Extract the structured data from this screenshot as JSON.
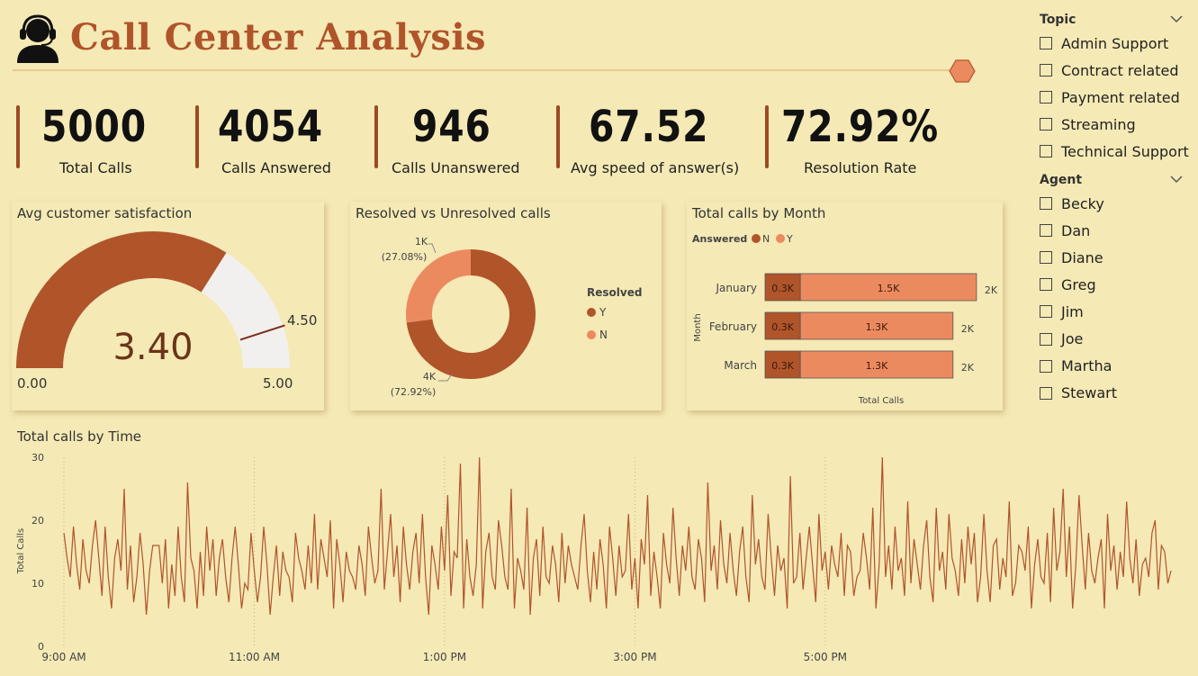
{
  "header": {
    "title": "Call Center Analysis",
    "logo_icon": "call-center-agent-icon"
  },
  "kpis": [
    {
      "value": "5000",
      "label": "Total Calls"
    },
    {
      "value": "4054",
      "label": "Calls Answered"
    },
    {
      "value": "946",
      "label": "Calls Unanswered"
    },
    {
      "value": "67.52",
      "label": "Avg speed of answer(s)"
    },
    {
      "value": "72.92%",
      "label": "Resolution Rate"
    }
  ],
  "gauge": {
    "title": "Avg customer satisfaction",
    "value": 3.4,
    "value_label": "3.40",
    "min": 0,
    "min_label": "0.00",
    "max": 5,
    "max_label": "5.00",
    "target": 4.5,
    "target_label": "4.50"
  },
  "donut": {
    "title": "Resolved vs Unresolved calls",
    "legend_title": "Resolved",
    "slices": [
      {
        "name": "Y",
        "value": 72.92,
        "label": "4K",
        "pct": "(72.92%)"
      },
      {
        "name": "N",
        "value": 27.08,
        "label": "1K",
        "pct": "(27.08%)"
      }
    ]
  },
  "month_chart": {
    "title": "Total calls by Month",
    "legend_title": "Answered",
    "legend": [
      "N",
      "Y"
    ],
    "ylabel": "Month",
    "xlabel": "Total Calls",
    "categories": [
      "January",
      "February",
      "March"
    ],
    "n_labels": [
      "0.3K",
      "0.3K",
      "0.3K"
    ],
    "y_labels": [
      "1.5K",
      "1.3K",
      "1.3K"
    ],
    "total_labels": [
      "2K",
      "2K",
      "2K"
    ]
  },
  "time_chart": {
    "title": "Total calls by Time",
    "ylabel": "Total Calls",
    "y_ticks": [
      "30",
      "20",
      "10",
      "0"
    ],
    "x_ticks": [
      "9:00 AM",
      "11:00 AM",
      "1:00 PM",
      "3:00 PM",
      "5:00 PM"
    ]
  },
  "slicers": {
    "topic": {
      "title": "Topic",
      "options": [
        "Admin Support",
        "Contract related",
        "Payment related",
        "Streaming",
        "Technical Support"
      ]
    },
    "agent": {
      "title": "Agent",
      "options": [
        "Becky",
        "Dan",
        "Diane",
        "Greg",
        "Jim",
        "Joe",
        "Martha",
        "Stewart"
      ]
    }
  },
  "colors": {
    "background": "#f5e9b5",
    "dark": "#b0542a",
    "light": "#ec8a5f",
    "gauge_rest": "#f1f0ee",
    "line": "#b0542a"
  },
  "chart_data": [
    {
      "type": "gauge",
      "title": "Avg customer satisfaction",
      "value": 3.4,
      "min": 0,
      "max": 5,
      "target": 4.5
    },
    {
      "type": "pie",
      "title": "Resolved vs Unresolved calls",
      "categories": [
        "Y",
        "N"
      ],
      "values": [
        72.92,
        27.08
      ]
    },
    {
      "type": "bar",
      "title": "Total calls by Month",
      "categories": [
        "January",
        "February",
        "March"
      ],
      "series": [
        {
          "name": "N",
          "values": [
            300,
            300,
            300
          ]
        },
        {
          "name": "Y",
          "values": [
            1500,
            1300,
            1300
          ]
        }
      ],
      "xlabel": "Total Calls",
      "ylabel": "Month"
    },
    {
      "type": "line",
      "title": "Total calls by Time",
      "xlabel": "",
      "ylabel": "Total Calls",
      "ylim": [
        0,
        30
      ],
      "x_range": [
        "9:00 AM",
        "5:59 PM"
      ],
      "x_start_minutes": 540,
      "step_minutes": 2,
      "series": [
        {
          "name": "Total Calls",
          "values": [
            18,
            14,
            11,
            19,
            13,
            9,
            17,
            12,
            10,
            16,
            20,
            14,
            8,
            19,
            11,
            6,
            14,
            17,
            12,
            25,
            9,
            16,
            7,
            11,
            18,
            13,
            5,
            12,
            16,
            16,
            16,
            10,
            17,
            6,
            13,
            8,
            19,
            11,
            7,
            26,
            14,
            12,
            6,
            15,
            8,
            19,
            12,
            17,
            8,
            14,
            17,
            11,
            7,
            14,
            19,
            13,
            6,
            10,
            9,
            18,
            12,
            7,
            11,
            19,
            13,
            5,
            11,
            16,
            8,
            15,
            12,
            11,
            7,
            18,
            14,
            12,
            9,
            16,
            10,
            21,
            9,
            17,
            14,
            11,
            20,
            6,
            17,
            13,
            7,
            15,
            12,
            11,
            9,
            16,
            13,
            8,
            19,
            14,
            10,
            12,
            25,
            9,
            15,
            21,
            11,
            16,
            7,
            19,
            13,
            9,
            15,
            18,
            10,
            21,
            11,
            5,
            16,
            13,
            9,
            19,
            12,
            24,
            8,
            15,
            14,
            29,
            6,
            17,
            11,
            8,
            13,
            30,
            6,
            15,
            18,
            11,
            9,
            20,
            16,
            11,
            9,
            25,
            6,
            14,
            12,
            9,
            22,
            5,
            14,
            17,
            8,
            19,
            11,
            10,
            16,
            13,
            7,
            18,
            10,
            16,
            13,
            11,
            9,
            16,
            21,
            12,
            7,
            15,
            9,
            17,
            13,
            6,
            19,
            14,
            8,
            16,
            11,
            12,
            21,
            9,
            14,
            6,
            17,
            13,
            24,
            8,
            15,
            11,
            6,
            18,
            13,
            10,
            22,
            14,
            8,
            16,
            12,
            19,
            11,
            9,
            17,
            14,
            7,
            26,
            12,
            16,
            9,
            20,
            13,
            10,
            18,
            12,
            8,
            15,
            19,
            11,
            7,
            24,
            13,
            17,
            11,
            9,
            21,
            14,
            8,
            16,
            12,
            14,
            6,
            27,
            10,
            11,
            18,
            9,
            14,
            19,
            13,
            7,
            21,
            12,
            15,
            9,
            16,
            13,
            11,
            18,
            8,
            16,
            15,
            8,
            11,
            12,
            18,
            14,
            9,
            22,
            6,
            13,
            30,
            11,
            16,
            9,
            19,
            12,
            14,
            8,
            23,
            10,
            17,
            13,
            9,
            16,
            20,
            11,
            7,
            22,
            12,
            15,
            9,
            21,
            14,
            12,
            8,
            17,
            10,
            19,
            13,
            18,
            7,
            11,
            21,
            12,
            7,
            16,
            17,
            9,
            14,
            11,
            23,
            8,
            10,
            16,
            15,
            12,
            19,
            6,
            13,
            17,
            11,
            10,
            18,
            7,
            22,
            12,
            15,
            25,
            11,
            19,
            6,
            13,
            24,
            16,
            9,
            18,
            12,
            10,
            14,
            17,
            6,
            21,
            12,
            16,
            9,
            15,
            11,
            23,
            14,
            10,
            17,
            8,
            13,
            14,
            11,
            18,
            20,
            9,
            16,
            15,
            10,
            12
          ]
        }
      ]
    }
  ]
}
